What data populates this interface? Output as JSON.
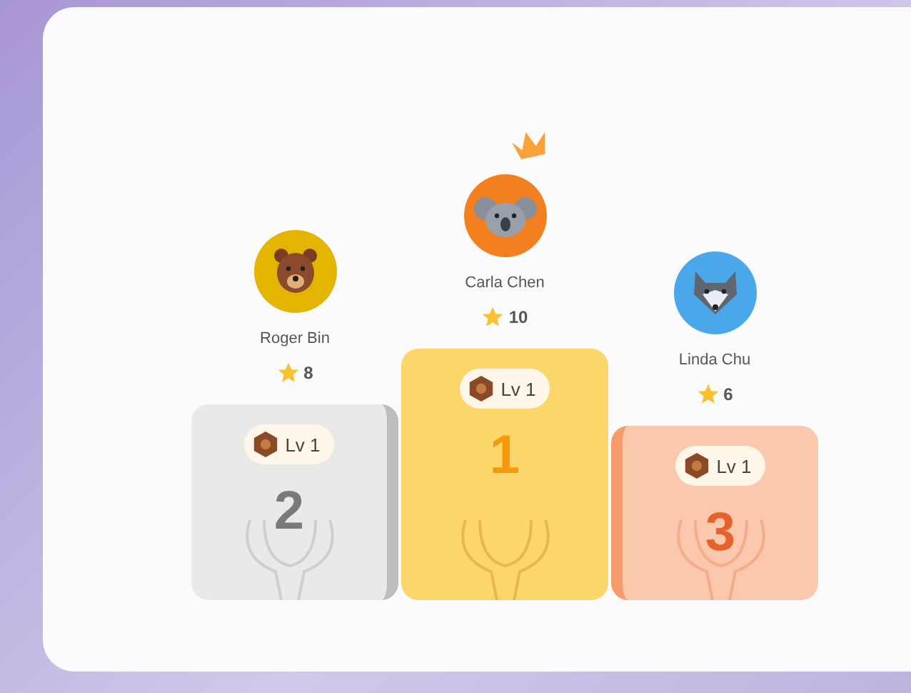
{
  "podium": [
    {
      "name": "Roger Bin",
      "score": "8",
      "level": "Lv 1",
      "rank": "2",
      "kind": "second"
    },
    {
      "name": "Carla Chen",
      "score": "10",
      "level": "Lv 1",
      "rank": "1",
      "kind": "first"
    },
    {
      "name": "Linda Chu",
      "score": "6",
      "level": "Lv 1",
      "rank": "3",
      "kind": "third"
    }
  ]
}
